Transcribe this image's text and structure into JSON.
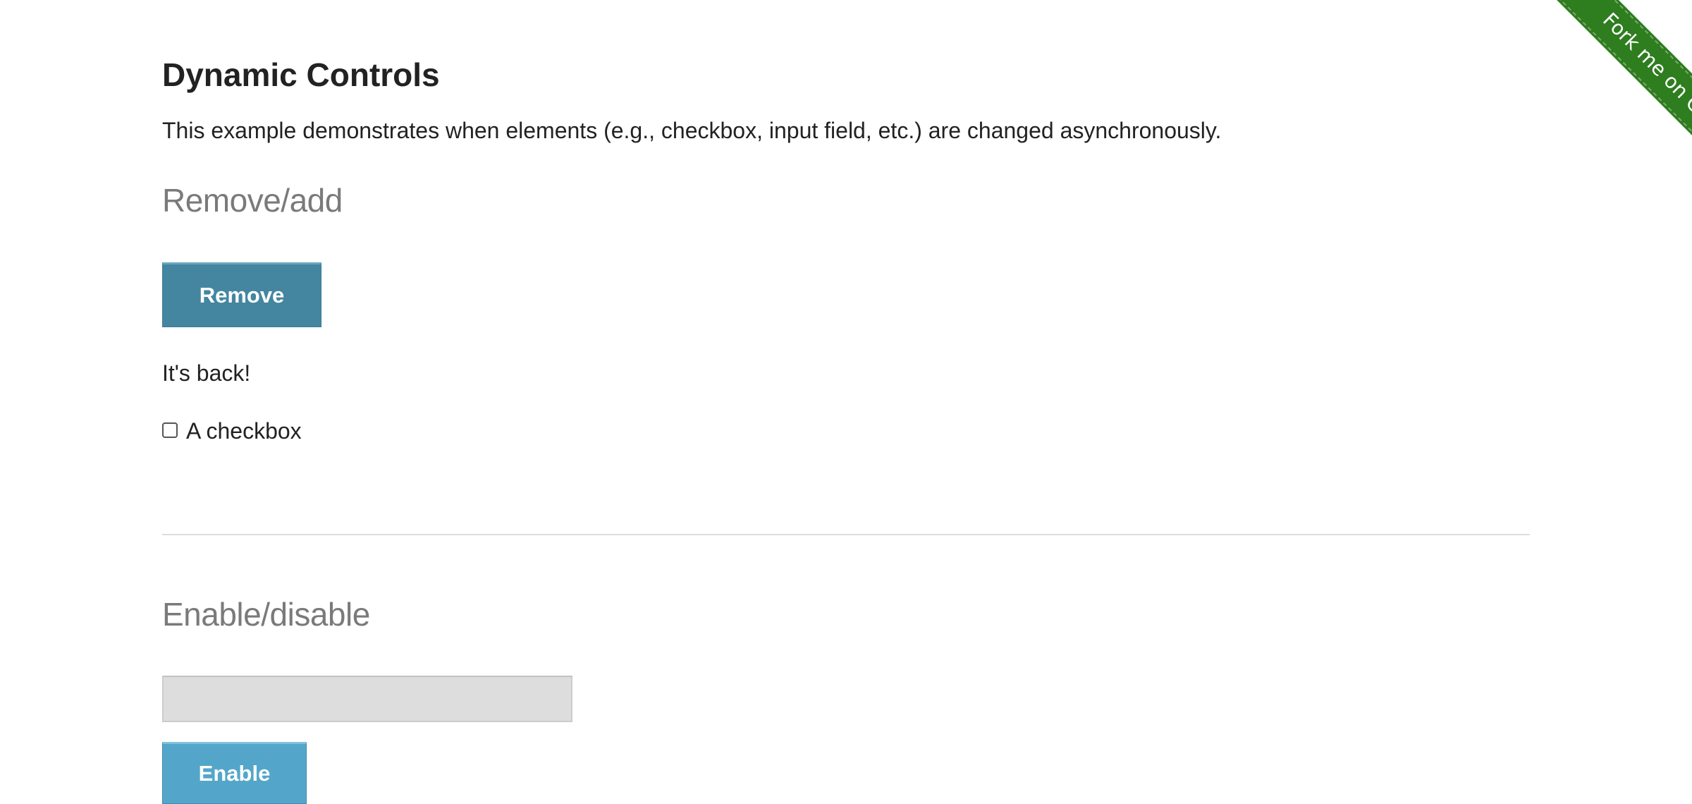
{
  "page": {
    "title": "Dynamic Controls",
    "description": "This example demonstrates when elements (e.g., checkbox, input field, etc.) are changed asynchronously."
  },
  "remove_add": {
    "heading": "Remove/add",
    "button_label": "Remove",
    "message": "It's back!",
    "checkbox": {
      "label": "A checkbox",
      "checked": false
    }
  },
  "enable_disable": {
    "heading": "Enable/disable",
    "input_value": "",
    "input_disabled": true,
    "button_label": "Enable"
  },
  "fork_ribbon": {
    "label": "Fork me on GitHub"
  },
  "colors": {
    "remove_button": "#44869f",
    "enable_button": "#53a6c9",
    "ribbon": "#2e7d1f",
    "section_heading": "#7a7a7a"
  }
}
